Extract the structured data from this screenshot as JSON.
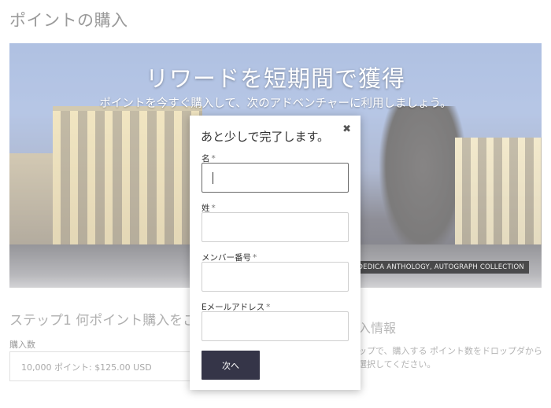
{
  "page": {
    "title": "ポイントの購入"
  },
  "hero": {
    "title": "リワードを短期間で獲得",
    "subtitle": "ポイントを今すぐ購入して、次のアドベンチャーに利用しましょう。",
    "caption": "THE DEDICA ANTHOLOGY, AUTOGRAPH COLLECTION"
  },
  "step1": {
    "title": "ステップ1 何ポイント購入をご",
    "quantity_label": "購入数",
    "quantity_value": "10,000 ポイント: $125.00 USD"
  },
  "info": {
    "title": "入情報",
    "text": "ップで、購入する ポイント数をドロップダから選択してください。"
  },
  "modal": {
    "title": "あと少しで完了します。",
    "close_icon": "close-icon",
    "fields": [
      {
        "label": "名",
        "required": "*",
        "value": ""
      },
      {
        "label": "姓",
        "required": "*",
        "value": ""
      },
      {
        "label": "メンバー番号",
        "required": "*",
        "value": ""
      },
      {
        "label": "Eメールアドレス",
        "required": "*",
        "value": ""
      }
    ],
    "submit_label": "次へ"
  },
  "colors": {
    "submit_button": "#353548",
    "page_title": "#9a9a9a"
  }
}
